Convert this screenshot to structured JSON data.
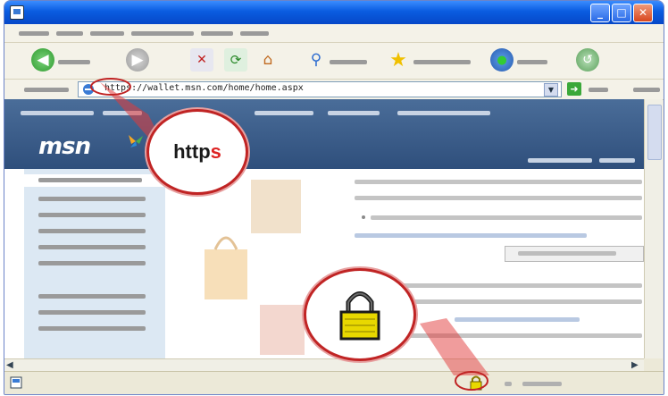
{
  "browser": {
    "address_url": "https://wallet.msn.com/home/home.aspx"
  },
  "page": {
    "logo": "msn"
  },
  "callouts": {
    "https_label": "http",
    "https_highlight": "s",
    "lock_icon": "padlock-icon"
  },
  "colors": {
    "titlebar": "#0a5ce0",
    "callout_border": "#c02424",
    "callout_fill": "#e23a3a",
    "padlock": "#e8d800",
    "msn_header": "#3a5a86",
    "leftnav": "#dce8f3"
  }
}
